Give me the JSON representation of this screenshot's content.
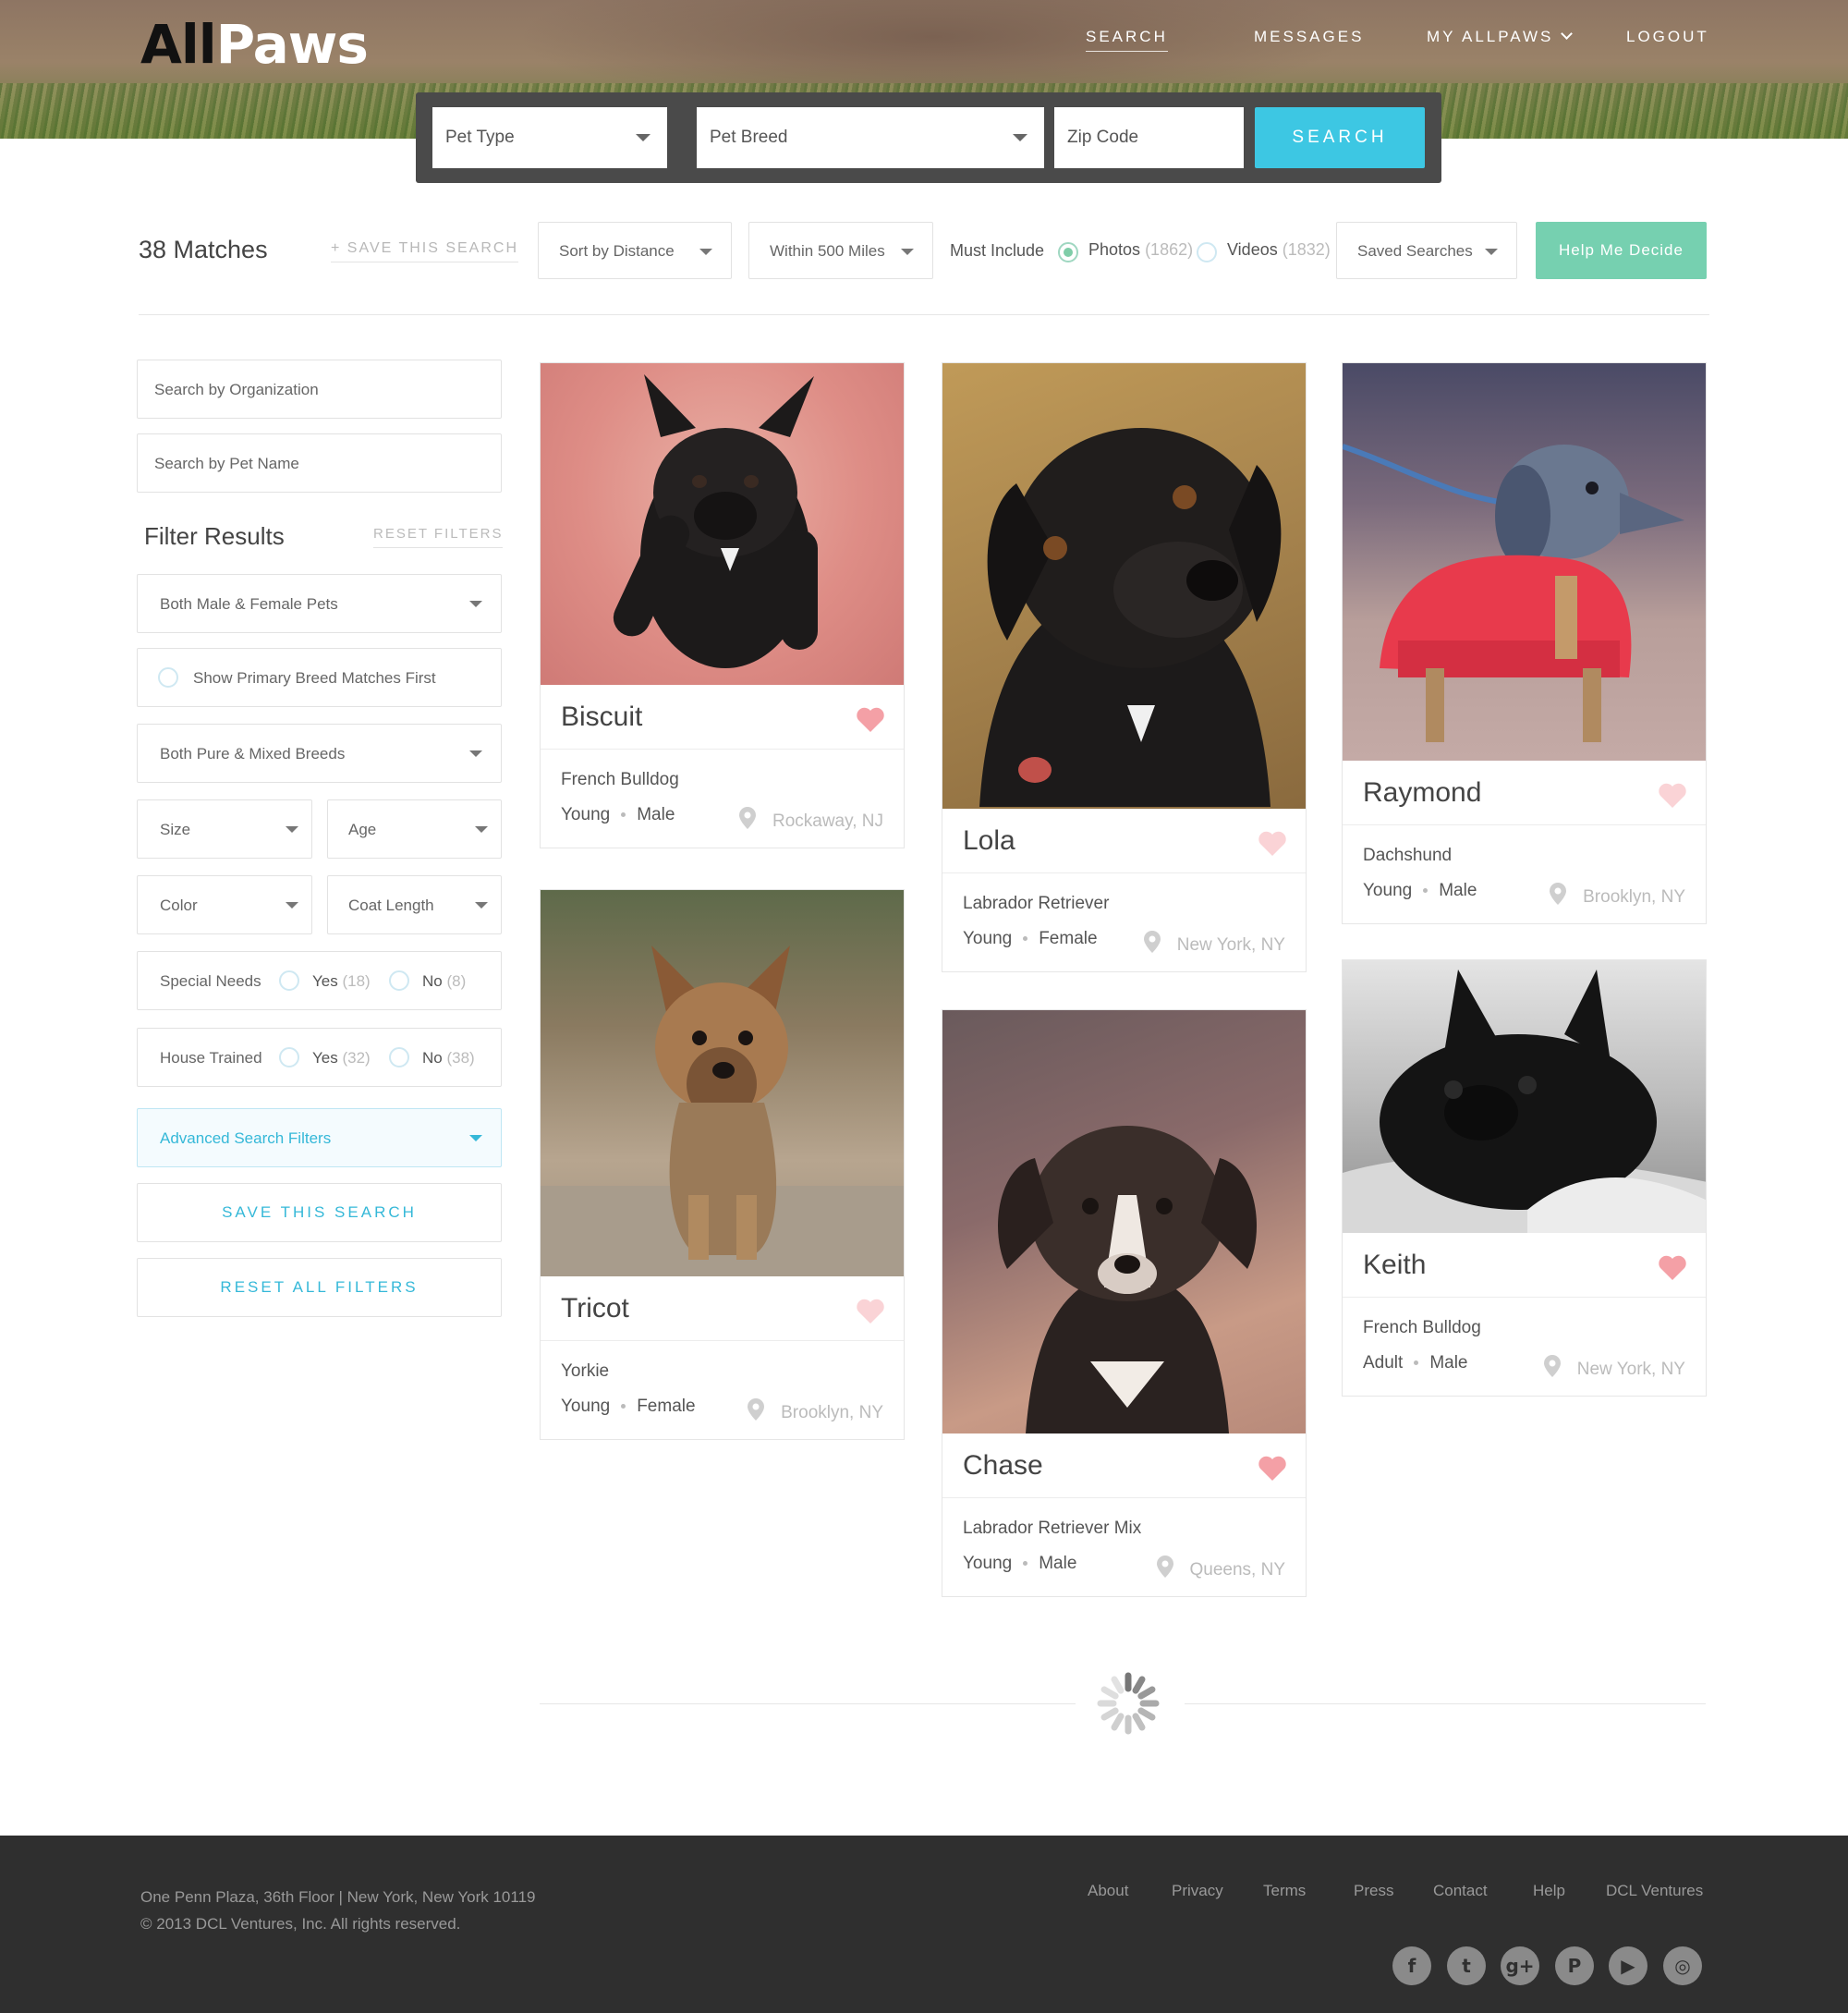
{
  "brand": {
    "logo_text_a": "All",
    "logo_text_b": "Paws"
  },
  "nav": {
    "search": "SEARCH",
    "messages": "MESSAGES",
    "my_allpaws": "MY ALLPAWS",
    "logout": "LOGOUT"
  },
  "searchbar": {
    "pet_type": "Pet Type",
    "pet_breed": "Pet Breed",
    "zip_placeholder": "Zip Code",
    "button": "SEARCH"
  },
  "toolbar": {
    "matches": "38 Matches",
    "save_search": "+ SAVE THIS SEARCH",
    "sort": "Sort by Distance",
    "distance": "Within 500 Miles",
    "must_include": "Must Include",
    "photos_label": "Photos",
    "photos_count": "(1862)",
    "videos_label": "Videos",
    "videos_count": "(1832)",
    "saved_searches": "Saved Searches",
    "help_button": "Help Me Decide"
  },
  "sidebar": {
    "org_placeholder": "Search by Organization",
    "name_placeholder": "Search by Pet Name",
    "filter_title": "Filter Results",
    "reset_filters": "RESET FILTERS",
    "gender": "Both Male & Female Pets",
    "primary_breed": "Show Primary Breed Matches First",
    "breed_purity": "Both Pure & Mixed Breeds",
    "size": "Size",
    "age": "Age",
    "color": "Color",
    "coat_length": "Coat Length",
    "special_needs": "Special Needs",
    "house_trained": "House Trained",
    "yes": "Yes",
    "no": "No",
    "special_yes_count": "(18)",
    "special_no_count": "(8)",
    "house_yes_count": "(32)",
    "house_no_count": "(38)",
    "advanced": "Advanced Search Filters",
    "save_button": "SAVE THIS SEARCH",
    "reset_all_button": "RESET ALL FILTERS"
  },
  "pets": [
    {
      "name": "Biscuit",
      "breed": "French Bulldog",
      "age": "Young",
      "gender": "Male",
      "location": "Rockaway, NJ",
      "favorited": true
    },
    {
      "name": "Lola",
      "breed": "Labrador Retriever",
      "age": "Young",
      "gender": "Female",
      "location": "New York, NY",
      "favorited": false
    },
    {
      "name": "Raymond",
      "breed": "Dachshund",
      "age": "Young",
      "gender": "Male",
      "location": "Brooklyn, NY",
      "favorited": false
    },
    {
      "name": "Tricot",
      "breed": "Yorkie",
      "age": "Young",
      "gender": "Female",
      "location": "Brooklyn, NY",
      "favorited": false
    },
    {
      "name": "Chase",
      "breed": "Labrador Retriever Mix",
      "age": "Young",
      "gender": "Male",
      "location": "Queens, NY",
      "favorited": true
    },
    {
      "name": "Keith",
      "breed": "French Bulldog",
      "age": "Adult",
      "gender": "Male",
      "location": "New York, NY",
      "favorited": true
    }
  ],
  "footer": {
    "address": "One Penn Plaza, 36th Floor | New York, New York 10119",
    "copyright": "© 2013 DCL Ventures, Inc. All rights reserved.",
    "links": [
      "About",
      "Privacy",
      "Terms",
      "Press",
      "Contact",
      "Help",
      "DCL Ventures"
    ],
    "social": [
      {
        "icon": "facebook-icon",
        "glyph": "f"
      },
      {
        "icon": "twitter-icon",
        "glyph": "t"
      },
      {
        "icon": "google-plus-icon",
        "glyph": "g+"
      },
      {
        "icon": "pinterest-icon",
        "glyph": "P"
      },
      {
        "icon": "youtube-icon",
        "glyph": "▶"
      },
      {
        "icon": "instagram-icon",
        "glyph": "◎"
      }
    ]
  },
  "colors": {
    "accent": "#3dc7e3",
    "help": "#76d0b0",
    "heart": "#f4a0a6",
    "footer": "#2f2f2f"
  }
}
